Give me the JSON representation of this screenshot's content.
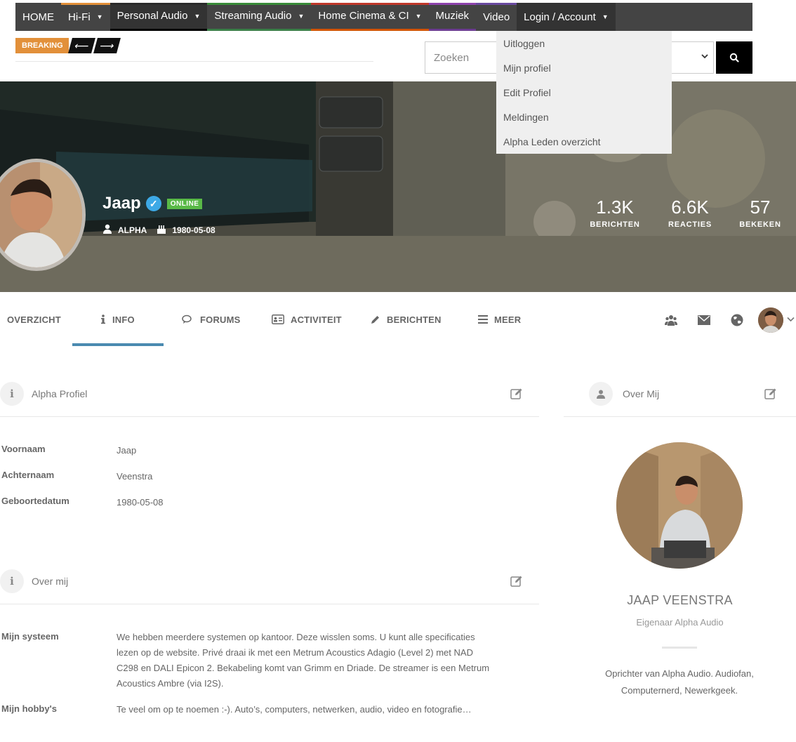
{
  "nav": {
    "items": [
      {
        "label": "HOME",
        "has_caret": false
      },
      {
        "label": "Hi-Fi",
        "has_caret": true
      },
      {
        "label": "Personal Audio",
        "has_caret": true
      },
      {
        "label": "Streaming Audio",
        "has_caret": true
      },
      {
        "label": "Home Cinema & CI",
        "has_caret": true
      },
      {
        "label": "Muziek",
        "has_caret": false
      },
      {
        "label": "Video",
        "has_caret": false
      },
      {
        "label": "Login / Account",
        "has_caret": true
      }
    ],
    "caret": "▼"
  },
  "breaking": {
    "label": "BREAKING",
    "prev": "⟵",
    "next": "⟶"
  },
  "search": {
    "placeholder": "Zoeken",
    "select_chevron": "⌄",
    "icon": "search-icon"
  },
  "account_menu": {
    "items": [
      "Uitloggen",
      "Mijn profiel",
      "Edit Profiel",
      "Meldingen",
      "Alpha Leden overzicht"
    ]
  },
  "profile": {
    "name": "Jaap",
    "verified": "✓",
    "status": "ONLINE",
    "role": "ALPHA",
    "birthdate": "1980-05-08",
    "stats": [
      {
        "value": "1.3K",
        "label": "BERICHTEN"
      },
      {
        "value": "6.6K",
        "label": "REACTIES"
      },
      {
        "value": "57",
        "label": "BEKEKEN"
      }
    ]
  },
  "tabs": [
    {
      "label": "OVERZICHT",
      "icon": "",
      "active": false
    },
    {
      "label": "INFO",
      "icon": "info-icon",
      "active": true
    },
    {
      "label": "FORUMS",
      "icon": "chat-icon",
      "active": false
    },
    {
      "label": "ACTIVITEIT",
      "icon": "id-card-icon",
      "active": false
    },
    {
      "label": "BERICHTEN",
      "icon": "pencil-icon",
      "active": false
    },
    {
      "label": "MEER",
      "icon": "menu-icon",
      "active": false
    }
  ],
  "alpha_profile": {
    "title": "Alpha Profiel",
    "fields": [
      {
        "label": "Voornaam",
        "value": "Jaap"
      },
      {
        "label": "Achternaam",
        "value": "Veenstra"
      },
      {
        "label": "Geboortedatum",
        "value": "1980-05-08"
      }
    ]
  },
  "over_mij_section": {
    "title": "Over mij",
    "fields": [
      {
        "label": "Mijn systeem",
        "value": "We hebben meerdere systemen op kantoor. Deze wisslen soms. U kunt alle specificaties lezen op de website. Privé draai ik met een Metrum Acoustics Adagio (Level 2) met NAD C298 en DALI Epicon 2. Bekabeling komt van Grimm en Driade. De streamer is een Metrum Acoustics Ambre (via I2S)."
      },
      {
        "label": "Mijn hobby's",
        "value": "Te veel om op te noemen :-). Auto’s, computers, netwerken, audio, video en fotografie…"
      }
    ]
  },
  "about_card": {
    "title": "Over Mij",
    "name": "JAAP VEENSTRA",
    "role": "Eigenaar Alpha Audio",
    "bio": "Oprichter van Alpha Audio. Audiofan, Computernerd, Newerkgeek."
  },
  "colors": {
    "accent": "#4a8ab0",
    "breaking": "#e2903a",
    "online": "#59b947",
    "verified": "#3da9e6",
    "nav": "#444444"
  }
}
